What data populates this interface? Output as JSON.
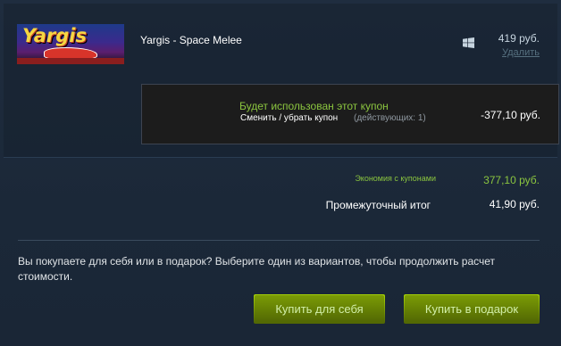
{
  "item": {
    "capsule_text": "Yargis",
    "title": "Yargis - Space Melee",
    "platform_icon": "windows-icon",
    "price": "419 руб.",
    "remove_label": "Удалить"
  },
  "coupon": {
    "title": "Будет использован этот купон",
    "change_label": "Сменить / убрать купон",
    "active_count": "(действующих: 1)",
    "discount": "-377,10 руб."
  },
  "totals": {
    "savings_label": "Экономия с купонами",
    "savings_value": "377,10 руб.",
    "subtotal_label": "Промежуточный итог",
    "subtotal_value": "41,90 руб."
  },
  "purchase": {
    "question": "Вы покупаете для себя или в подарок? Выберите один из вариантов, чтобы продолжить расчет стоимости.",
    "buy_self_label": "Купить для себя",
    "buy_gift_label": "Купить в подарок"
  },
  "colors": {
    "background": "#1b2838",
    "accent_green": "#8bc53f",
    "button_green": "#799905"
  }
}
